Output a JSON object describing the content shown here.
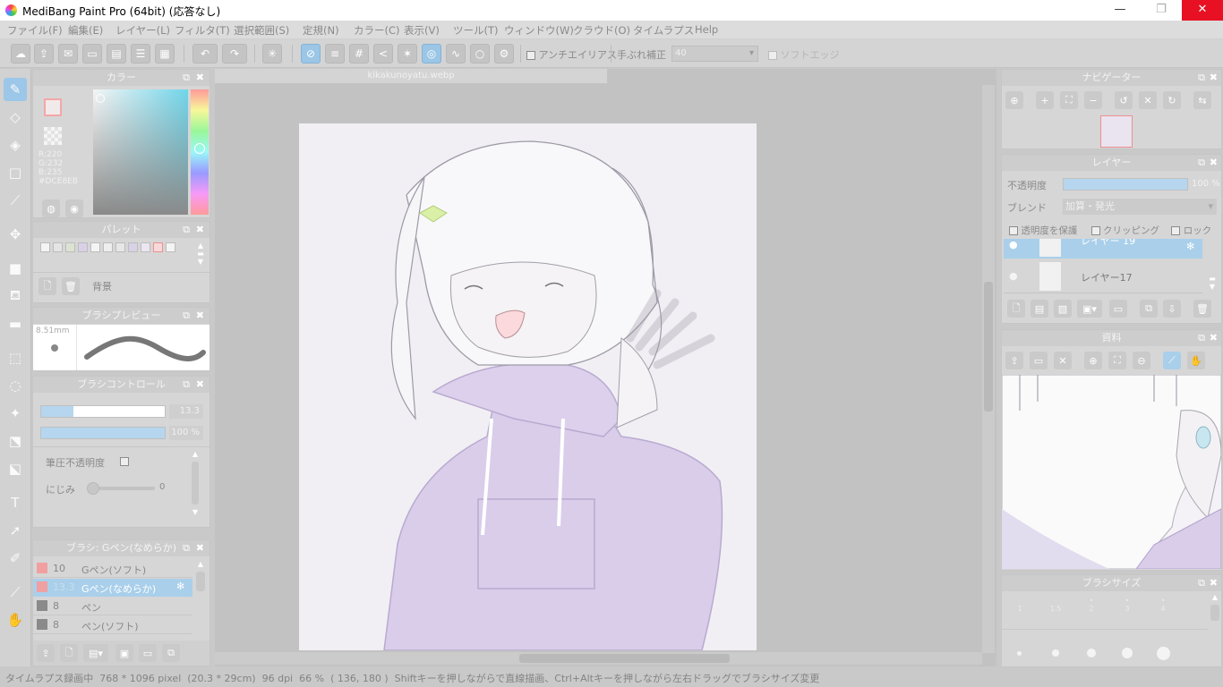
{
  "titlebar": {
    "title": "MediBang Paint Pro (64bit) (応答なし)",
    "minimize": "—",
    "maximize": "❐",
    "close": "✕"
  },
  "menu": [
    "ファイル(F)",
    "編集(E)",
    "レイヤー(L)",
    "フィルタ(T)",
    "選択範囲(S)",
    "定規(N)",
    "カラー(C)",
    "表示(V)",
    "ツール(T)",
    "ウィンドウ(W)",
    "クラウド(O)",
    "タイムラプス",
    "Help"
  ],
  "toolbar": {
    "antialias_label": "アンチエイリアス",
    "stabilizer_label": "手ぶれ補正",
    "stabilizer_value": "40",
    "soft_edge_label": "ソフトエッジ"
  },
  "color_panel": {
    "title": "カラー",
    "r": "R:220",
    "g": "G:232",
    "b": "B:235",
    "hex": "#DCE8EB"
  },
  "palette_panel": {
    "title": "パレット",
    "name": "背景",
    "swatches": [
      "#f4f4f4",
      "#e4e4e4",
      "#dde3d2",
      "#d8d1e6",
      "#f4f4f4",
      "#eeeeee",
      "#e6e6e6",
      "#d9d2e6",
      "#ece6f0",
      "#f7d9d9",
      "#f4f4f4"
    ]
  },
  "brush_preview": {
    "title": "ブラシプレビュー",
    "size": "8.51mm"
  },
  "brush_control": {
    "title": "ブラシコントロール",
    "size_value": "13.3",
    "opacity_value": "100 %",
    "pressure_label": "筆圧不透明度",
    "blur_label": "にじみ",
    "blur_value": "0"
  },
  "brush_list": {
    "title": "ブラシ: Gペン(なめらか)",
    "items": [
      {
        "size": "10",
        "name": "Gペン(ソフト)",
        "color": "#f0a0a0"
      },
      {
        "size": "13.3",
        "name": "Gペン(なめらか)",
        "color": "#f0a0a0"
      },
      {
        "size": "8",
        "name": "ペン",
        "color": "#8a8a8a"
      },
      {
        "size": "8",
        "name": "ペン(ソフト)",
        "color": "#8a8a8a"
      }
    ]
  },
  "document": {
    "tab": "kikakunoyatu.webp"
  },
  "navigator": {
    "title": "ナビゲーター"
  },
  "layer_panel": {
    "title": "レイヤー",
    "opacity_label": "不透明度",
    "opacity_value": "100 %",
    "blend_label": "ブレンド",
    "blend_value": "加算・発光",
    "protect_alpha": "透明度を保護",
    "clipping": "クリッピング",
    "lock": "ロック",
    "layers": [
      {
        "name": "レイヤー 19"
      },
      {
        "name": "レイヤー17"
      }
    ]
  },
  "material_panel": {
    "title": "資料"
  },
  "brush_size_panel": {
    "title": "ブラシサイズ",
    "sizes": [
      "1",
      "1.5",
      "2",
      "3",
      "4"
    ]
  },
  "status": {
    "timelapse": "タイムラプス録画中",
    "size": "768 * 1096 pixel",
    "cm": "(20.3 * 29cm)",
    "dpi": "96 dpi",
    "zoom": "66 %",
    "coords": "( 136, 180 )",
    "hint": "Shiftキーを押しながらで直線描画、Ctrl+Altキーを押しながら左右ドラッグでブラシサイズ変更"
  },
  "colors": {
    "accent": "#9cc7e8",
    "hoodie": "#d9cdea",
    "bow": "#d9f0a6"
  }
}
